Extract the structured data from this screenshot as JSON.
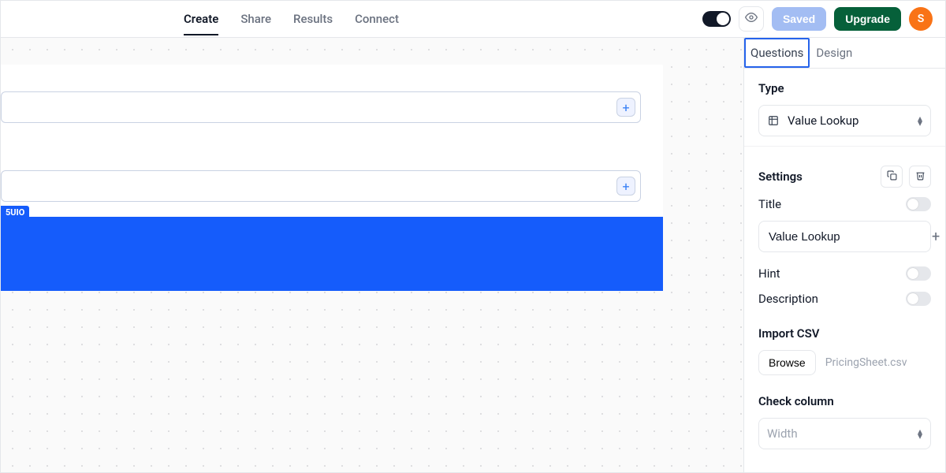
{
  "header": {
    "tabs": [
      "Create",
      "Share",
      "Results",
      "Connect"
    ],
    "active_tab": 0,
    "saved_label": "Saved",
    "upgrade_label": "Upgrade",
    "avatar_initial": "S"
  },
  "canvas": {
    "block_badge": "5UIO"
  },
  "sidebar": {
    "tabs": [
      "Questions",
      "Design"
    ],
    "active_tab": 0,
    "type_label": "Type",
    "type_value": "Value Lookup",
    "settings_label": "Settings",
    "title_label": "Title",
    "title_value": "Value Lookup",
    "hint_label": "Hint",
    "description_label": "Description",
    "import_label": "Import CSV",
    "browse_label": "Browse",
    "file_name": "PricingSheet.csv",
    "check_column_label": "Check column",
    "width_label": "Width"
  }
}
